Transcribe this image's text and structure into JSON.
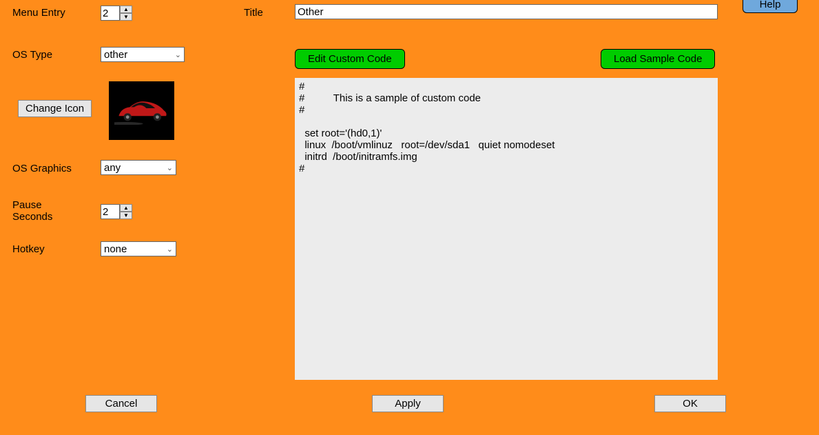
{
  "help_button": "Help",
  "labels": {
    "menu_entry": "Menu Entry",
    "title": "Title",
    "os_type": "OS Type",
    "change_icon": "Change Icon",
    "os_graphics": "OS Graphics",
    "pause_seconds": "Pause\nSeconds",
    "hotkey": "Hotkey"
  },
  "fields": {
    "menu_entry_value": "2",
    "title_value": "Other",
    "os_type_value": "other",
    "os_graphics_value": "any",
    "pause_seconds_value": "2",
    "hotkey_value": "none"
  },
  "buttons": {
    "edit_custom_code": "Edit Custom Code",
    "load_sample_code": "Load Sample Code",
    "cancel": "Cancel",
    "apply": "Apply",
    "ok": "OK"
  },
  "code_text": "#\n#          This is a sample of custom code\n#\n\n  set root='(hd0,1)'\n  linux  /boot/vmlinuz   root=/dev/sda1   quiet nomodeset\n  initrd  /boot/initramfs.img\n#"
}
